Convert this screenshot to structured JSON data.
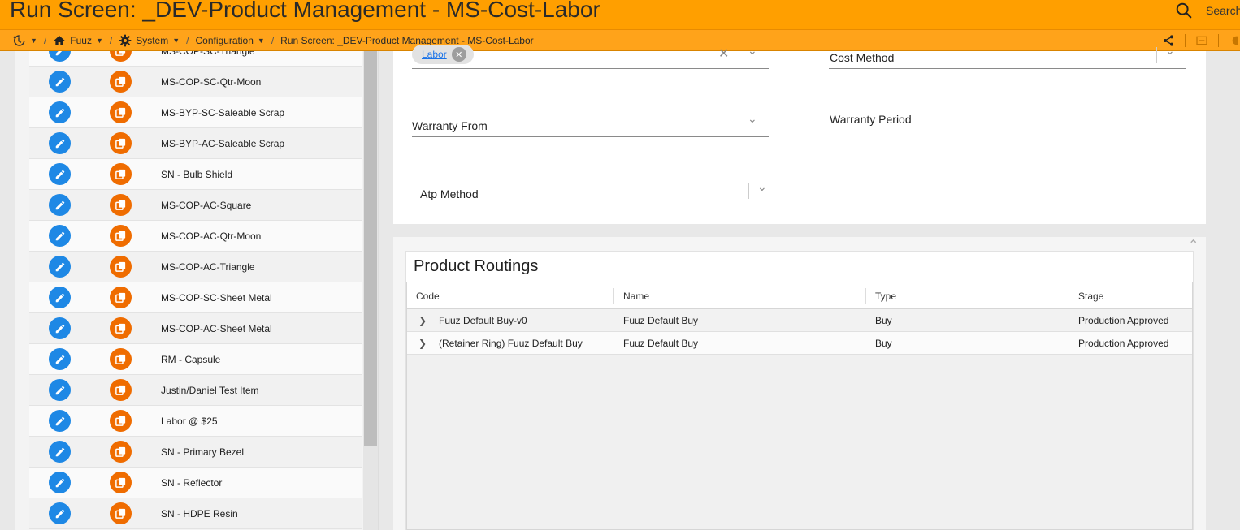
{
  "window": {
    "title": "Run Screen: _DEV-Product Management - MS-Cost-Labor"
  },
  "search": {
    "label": "Search"
  },
  "breadcrumb": {
    "items": [
      {
        "label": "Fuuz",
        "icon": "home-icon"
      },
      {
        "label": "System",
        "icon": "gear-icon"
      },
      {
        "label": "Configuration",
        "icon": ""
      },
      {
        "label": "Run Screen: _DEV-Product Management - MS-Cost-Labor",
        "icon": ""
      }
    ],
    "colors": {
      "titlebar": "#ff9f00",
      "crumbbar": "#ffa31a"
    }
  },
  "item_list": {
    "rows": [
      {
        "label": "MS-COP-SC-Triangle"
      },
      {
        "label": "MS-COP-SC-Qtr-Moon"
      },
      {
        "label": "MS-BYP-SC-Saleable Scrap"
      },
      {
        "label": "MS-BYP-AC-Saleable Scrap"
      },
      {
        "label": "SN - Bulb Shield"
      },
      {
        "label": "MS-COP-AC-Square"
      },
      {
        "label": "MS-COP-AC-Qtr-Moon"
      },
      {
        "label": "MS-COP-AC-Triangle"
      },
      {
        "label": "MS-COP-SC-Sheet Metal"
      },
      {
        "label": "MS-COP-AC-Sheet Metal"
      },
      {
        "label": "RM - Capsule"
      },
      {
        "label": "Justin/Daniel Test Item"
      },
      {
        "label": "Labor @ $25"
      },
      {
        "label": "SN - Primary Bezel"
      },
      {
        "label": "SN - Reflector"
      },
      {
        "label": "SN - HDPE Resin"
      }
    ],
    "colors": {
      "edit": "#1e88e5",
      "copy": "#ef6c00"
    }
  },
  "form": {
    "chip_label": "Labor",
    "cost_method_label": "Cost Method",
    "warranty_from_label": "Warranty From",
    "warranty_period_label": "Warranty Period",
    "atp_method_label": "Atp Method"
  },
  "routings": {
    "title": "Product Routings",
    "columns": [
      "Code",
      "Name",
      "Type",
      "Stage"
    ],
    "rows": [
      {
        "code": "Fuuz Default Buy-v0",
        "name": "Fuuz Default Buy",
        "type": "Buy",
        "stage": "Production Approved"
      },
      {
        "code": "(Retainer Ring) Fuuz Default Buy",
        "name": "Fuuz Default Buy",
        "type": "Buy",
        "stage": "Production Approved"
      }
    ]
  }
}
